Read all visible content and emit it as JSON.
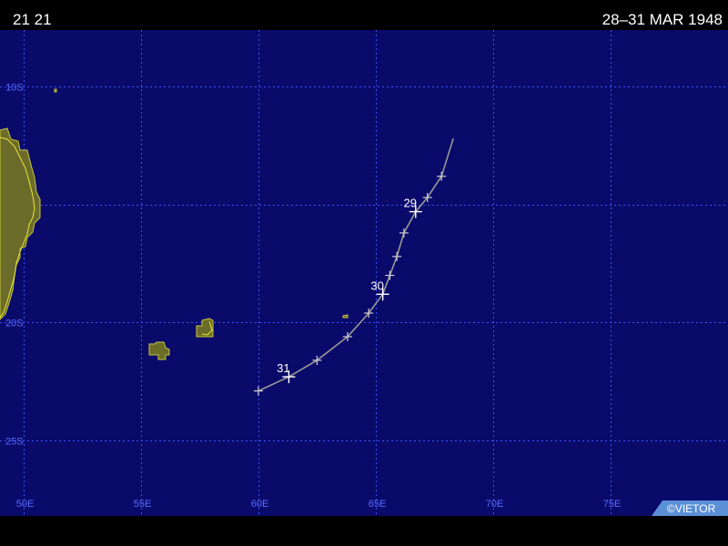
{
  "header": {
    "storm_id": "21 21",
    "date_range": "28–31 MAR 1948"
  },
  "map": {
    "background_color": "#0a0a6a",
    "lon_range": [
      49,
      80
    ],
    "lat_range": [
      -28.2,
      -7.6
    ],
    "lon_ticks": [
      {
        "value": 50,
        "label": "50E"
      },
      {
        "value": 55,
        "label": "55E"
      },
      {
        "value": 60,
        "label": "60E"
      },
      {
        "value": 65,
        "label": "65E"
      },
      {
        "value": 70,
        "label": "70E"
      },
      {
        "value": 75,
        "label": "75E"
      }
    ],
    "lat_ticks": [
      {
        "value": -10,
        "label": "10S"
      },
      {
        "value": -15,
        "label": "15S"
      },
      {
        "value": -20,
        "label": "20S"
      },
      {
        "value": -25,
        "label": "25S"
      }
    ],
    "credit": "©VIETOR"
  },
  "track": {
    "line_color": "#9a9a9a",
    "points": [
      {
        "lon": 68.3,
        "lat": -12.2
      },
      {
        "lon": 67.8,
        "lat": -13.8,
        "day": ""
      },
      {
        "lon": 67.2,
        "lat": -14.7,
        "day": ""
      },
      {
        "lon": 66.7,
        "lat": -15.3,
        "day": "29"
      },
      {
        "lon": 66.2,
        "lat": -16.2,
        "day": ""
      },
      {
        "lon": 65.9,
        "lat": -17.2,
        "day": ""
      },
      {
        "lon": 65.6,
        "lat": -18.0,
        "day": ""
      },
      {
        "lon": 65.3,
        "lat": -18.8,
        "day": "30"
      },
      {
        "lon": 64.7,
        "lat": -19.6,
        "day": ""
      },
      {
        "lon": 63.8,
        "lat": -20.6,
        "day": ""
      },
      {
        "lon": 62.5,
        "lat": -21.6,
        "day": ""
      },
      {
        "lon": 61.3,
        "lat": -22.3,
        "day": "31"
      },
      {
        "lon": 60.0,
        "lat": -22.9,
        "day": ""
      }
    ]
  }
}
